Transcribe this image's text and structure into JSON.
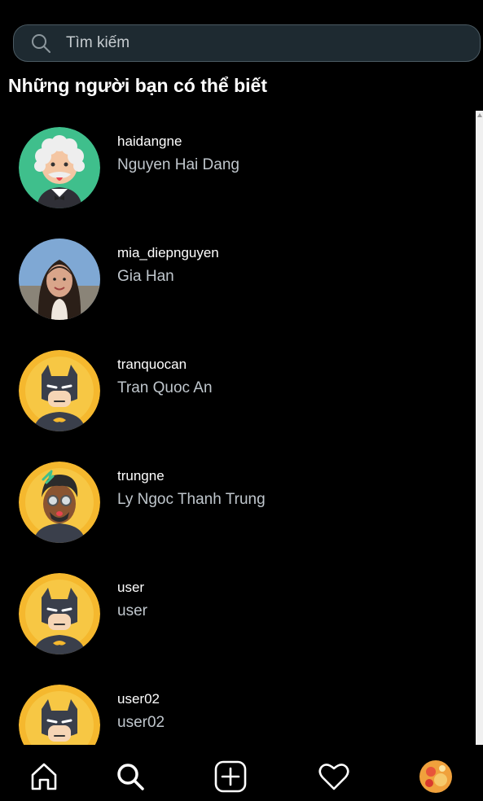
{
  "search": {
    "placeholder": "Tìm kiếm",
    "icon": "search-icon"
  },
  "section_title": "Những người bạn có thể biết",
  "suggestions": [
    {
      "username": "haidangne",
      "fullname": "Nguyen Hai Dang",
      "avatar": "old-man-avatar"
    },
    {
      "username": "mia_diepnguyen",
      "fullname": "Gia Han",
      "avatar": "photo-avatar"
    },
    {
      "username": "tranquocan",
      "fullname": "Tran Quoc An",
      "avatar": "batman-avatar"
    },
    {
      "username": "trungne",
      "fullname": "Ly Ngoc Thanh Trung",
      "avatar": "glasses-man-avatar"
    },
    {
      "username": "user",
      "fullname": "user",
      "avatar": "batman-avatar"
    },
    {
      "username": "user02",
      "fullname": "user02",
      "avatar": "batman-avatar"
    }
  ],
  "nav": {
    "items": [
      "home-icon",
      "search-icon",
      "add-post-icon",
      "heart-icon",
      "profile-avatar"
    ]
  },
  "colors": {
    "background": "#000000",
    "search_bg": "#1e2a31",
    "search_border": "#4b5a62",
    "muted_text": "#bfc6cc"
  }
}
